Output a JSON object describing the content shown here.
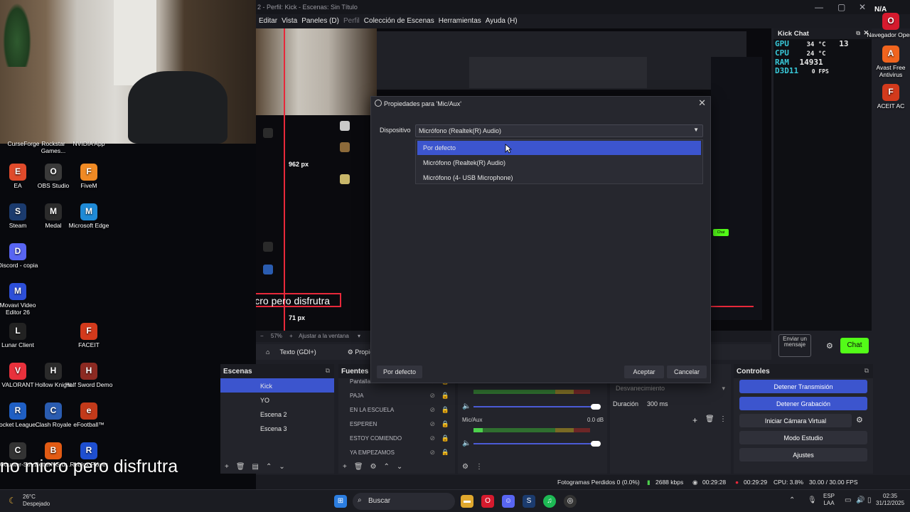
{
  "obs": {
    "window_title": "2 - Perfil: Kick - Escenas: Sin Título",
    "menu": [
      "Editar",
      "Vista",
      "Paneles (D)",
      "Perfil",
      "Colección de Escenas",
      "Herramientas",
      "Ayuda (H)"
    ],
    "preview": {
      "px_top": "962 px",
      "px_bottom": "71 px",
      "caption": "no micro pero disfrutra"
    },
    "zoom": "57%",
    "zoom_fit": "Ajustar a la ventana",
    "source_toolbar": {
      "source": "Texto (GDI+)",
      "properties": "Propiedades"
    },
    "scenes": {
      "title": "Escenas",
      "items": [
        "Kick",
        "YO",
        "Escena 2",
        "Escena 3"
      ],
      "active_index": 0
    },
    "sources": {
      "title": "Fuentes",
      "items": [
        "Pantalla",
        "PAJA",
        "EN LA ESCUELA",
        "ESPEREN",
        "ESTOY COMIENDO",
        "YA EMPEZAMOS"
      ]
    },
    "mixer": {
      "channel_2": {
        "name": "Mic/Aux",
        "db": "0.0 dB"
      }
    },
    "transitions": {
      "type": "Desvanecimiento",
      "duration_label": "Duración",
      "duration_value": "300 ms"
    },
    "controls": {
      "title": "Controles",
      "stop_stream": "Detener Transmisión",
      "stop_record": "Detener Grabación",
      "virtual_cam": "Iniciar Cámara Virtual",
      "studio_mode": "Modo Estudio",
      "settings": "Ajustes"
    },
    "status": {
      "dropped": "Fotogramas Perdidos 0 (0.0%)",
      "bitrate": "2688 kbps",
      "stream_time": "00:29:28",
      "rec_time": "00:29:29",
      "cpu": "CPU: 3.8%",
      "fps": "30.00 / 30.00 FPS"
    },
    "kick_chat": {
      "title": "Kick Chat",
      "input_placeholder": "Enviar un mensaje",
      "chat_button": "Chat",
      "overlay_chat": "Chat"
    },
    "hw": {
      "gpu_label": "GPU",
      "gpu_temp": "34 °C",
      "gpu_load": "13",
      "cpu_label": "CPU",
      "cpu_temp": "24 °C",
      "ram_label": "RAM",
      "ram_val": "14931",
      "d3d_label": "D3D11",
      "fps_val": "0 FPS"
    }
  },
  "dialog": {
    "title": "Propiedades para 'Mic/Aux'",
    "device_label": "Dispositivo",
    "device_value": "Micrófono (Realtek(R) Audio)",
    "options": [
      "Por defecto",
      "Micrófono (Realtek(R) Audio)",
      "Micrófono (4- USB Microphone)"
    ],
    "selected_index": 0,
    "defaults_button": "Por defecto",
    "ok_button": "Aceptar",
    "cancel_button": "Cancelar"
  },
  "desktop": {
    "icons": [
      {
        "label": "EA",
        "color": "#e04b2b"
      },
      {
        "label": "OBS Studio",
        "color": "#3a3a3a"
      },
      {
        "label": "FiveM",
        "color": "#f08a24"
      },
      {
        "label": "Steam",
        "color": "#1b3b6e"
      },
      {
        "label": "Medal",
        "color": "#2b2b2b"
      },
      {
        "label": "Microsoft Edge",
        "color": "#1f8ad6"
      },
      {
        "label": "Discord - copia",
        "color": "#5865f2"
      },
      {
        "label": "Movavi Video Editor 26",
        "color": "#2d4fd8"
      },
      {
        "label": "Lunar Client",
        "color": "#222"
      },
      {
        "label": "FACEIT",
        "color": "#d33a1c"
      },
      {
        "label": "VALORANT",
        "color": "#e8313c"
      },
      {
        "label": "Hollow Knight",
        "color": "#2a2a2a"
      },
      {
        "label": "Half Sword Demo",
        "color": "#8c2a22"
      },
      {
        "label": "Rocket League...",
        "color": "#1f5fc4"
      },
      {
        "label": "Clash Royale",
        "color": "#2a5cb0"
      },
      {
        "label": "eFootball™",
        "color": "#c23a1a"
      },
      {
        "label": "Counter-Str...",
        "color": "#333"
      },
      {
        "label": "BetterNG dr...",
        "color": "#e25b14"
      },
      {
        "label": "Roblox Player",
        "color": "#1e4fd0"
      }
    ],
    "top_row": [
      "CurseForge",
      "Rockstar Games...",
      "NVIDIA App"
    ],
    "right_icons": [
      {
        "label": "Navegador Opera",
        "color": "#d61a2e"
      },
      {
        "label": "Avast Free Antivirus",
        "color": "#f0641e"
      },
      {
        "label": "ACEIT AC",
        "color": "#d33a1c"
      }
    ],
    "right_top_label": "N/A",
    "overlay_caption": "no micro pero disfrutra"
  },
  "taskbar": {
    "weather_temp": "26°C",
    "weather_desc": "Despejado",
    "search_placeholder": "Buscar",
    "lang": "ESP",
    "lang2": "LAA",
    "time": "02:35",
    "date": "31/12/2025"
  }
}
